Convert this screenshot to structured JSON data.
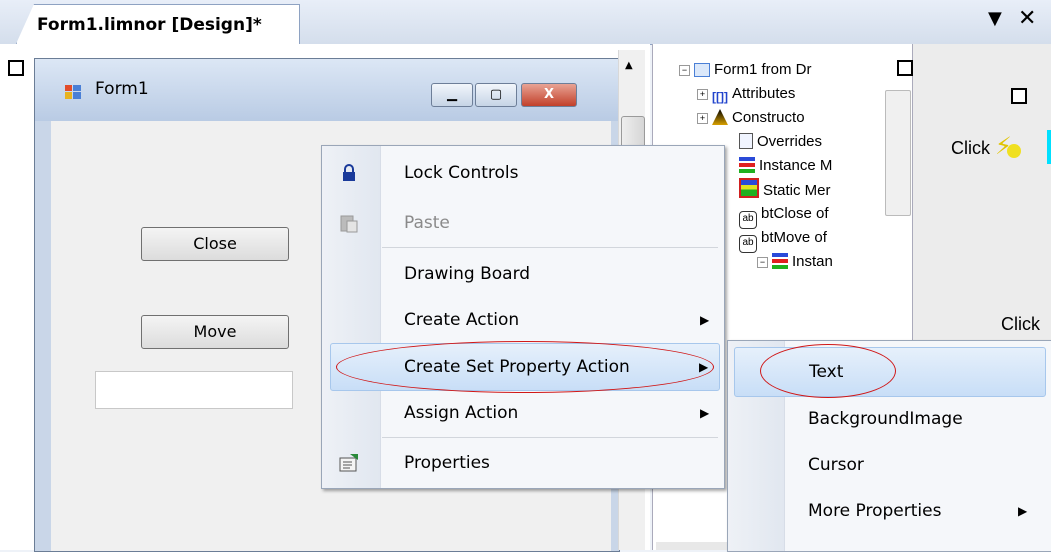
{
  "document_tab": {
    "title": "Form1.limnor [Design]*"
  },
  "form": {
    "title": "Form1",
    "caption_buttons": {
      "minimize": "▁",
      "maximize": "▢",
      "close": "X"
    },
    "close_button_label": "Close",
    "move_button_label": "Move",
    "text_value": ""
  },
  "tree": {
    "items": [
      {
        "label": "Form1 from Dr"
      },
      {
        "label": "Attributes"
      },
      {
        "label": "Constructo"
      },
      {
        "label": "Overrides"
      },
      {
        "label": "Instance M"
      },
      {
        "label": "Static Mer"
      },
      {
        "label": "btClose of"
      },
      {
        "label": "btMove of"
      },
      {
        "label": "Instan"
      }
    ]
  },
  "flow": {
    "click_label_1": "Click",
    "click_label_2": "Click"
  },
  "context_menu": {
    "items": [
      {
        "label": "Lock Controls",
        "icon": "lock-icon"
      },
      {
        "label": "Paste",
        "icon": "paste-icon",
        "disabled": true
      },
      {
        "label": "Drawing Board"
      },
      {
        "label": "Create Action",
        "submenu": true
      },
      {
        "label": "Create Set Property Action",
        "submenu": true,
        "highlighted": true
      },
      {
        "label": "Assign Action",
        "submenu": true
      },
      {
        "label": "Properties",
        "icon": "properties-icon"
      }
    ]
  },
  "submenu": {
    "items": [
      {
        "label": "Text",
        "highlighted": true
      },
      {
        "label": "BackgroundImage"
      },
      {
        "label": "Cursor"
      },
      {
        "label": "More Properties",
        "submenu": true
      }
    ]
  },
  "colors": {
    "highlight": "#c8def7",
    "annotation": "#d01818",
    "titlebar": "#c9d6e8"
  }
}
